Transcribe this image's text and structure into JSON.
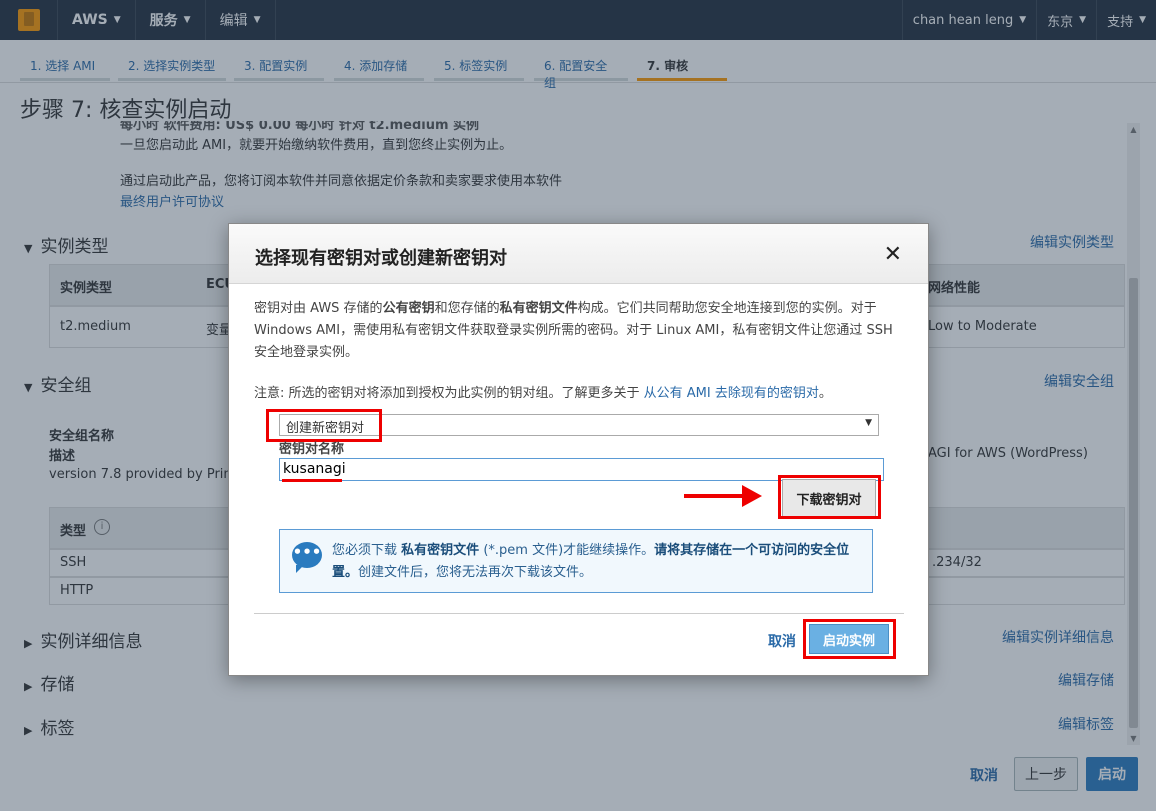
{
  "topnav": {
    "aws": "AWS",
    "services": "服务",
    "edit": "编辑",
    "user": "chan hean leng",
    "region": "东京",
    "support": "支持"
  },
  "steps": [
    "1. 选择 AMI",
    "2. 选择实例类型",
    "3. 配置实例",
    "4. 添加存储",
    "5. 标签实例",
    "6. 配置安全组",
    "7. 审核"
  ],
  "page_title": "步骤 7: 核查实例启动",
  "background": {
    "partial_top": "每小时 软件费用: US$ 0.00 每小时 针对 t2.medium 实例",
    "billing_line": "一旦您启动此 AMI，就要开始缴纳软件费用，直到您终止实例为止。",
    "agree_line": "通过启动此产品，您将订阅本软件并同意依据定价条款和卖家要求使用本软件",
    "eula_link": "最终用户许可协议",
    "instance_type_section": "实例类型",
    "instance_type_edit": "编辑实例类型",
    "instance_table_headers": [
      "实例类型",
      "ECU",
      "网络性能"
    ],
    "instance_table_values": [
      "t2.medium",
      "变量",
      "Low to Moderate"
    ],
    "security_section": "安全组",
    "security_edit": "编辑安全组",
    "sg_name_label": "安全组名称",
    "sg_desc_label": "描述",
    "sg_desc_value": "version 7.8 provided by Prim",
    "sg_right_value": "AGI for AWS (WordPress)",
    "rules_header": "类型",
    "rules_rows": [
      "SSH",
      "HTTP"
    ],
    "rules_right_value": ".234/32",
    "details_section": "实例详细信息",
    "details_edit": "编辑实例详细信息",
    "storage_section": "存储",
    "storage_edit": "编辑存储",
    "tags_section": "标签",
    "tags_edit": "编辑标签",
    "cancel": "取消",
    "previous": "上一步",
    "launch": "启动"
  },
  "modal": {
    "title": "选择现有密钥对或创建新密钥对",
    "desc_1": "密钥对由 AWS 存储的",
    "desc_b1": "公有密钥",
    "desc_2": "和您存储的",
    "desc_b2": "私有密钥文件",
    "desc_3": "构成。它们共同帮助您安全地连接到您的实例。对于 Windows AMI，需使用私有密钥文件获取登录实例所需的密码。对于 Linux AMI，私有密钥文件让您通过 SSH 安全地登录实例。",
    "note_text": "注意: 所选的密钥对将添加到授权为此实例的钥对组。了解更多关于",
    "note_link": "从公有 AMI 去除现有的密钥对",
    "note_end": "。",
    "select_value": "创建新密钥对",
    "field_label": "密钥对名称",
    "key_name": "kusanagi",
    "download_button": "下载密钥对",
    "info_1": "您必须下载",
    "info_b1": "私有密钥文件",
    "info_2": "(*.pem 文件)才能继续操作。",
    "info_b2": "请将其存储在一个可访问的安全位置。",
    "info_3": "创建文件后，您将无法再次下载该文件。",
    "cancel": "取消",
    "launch": "启动实例"
  }
}
